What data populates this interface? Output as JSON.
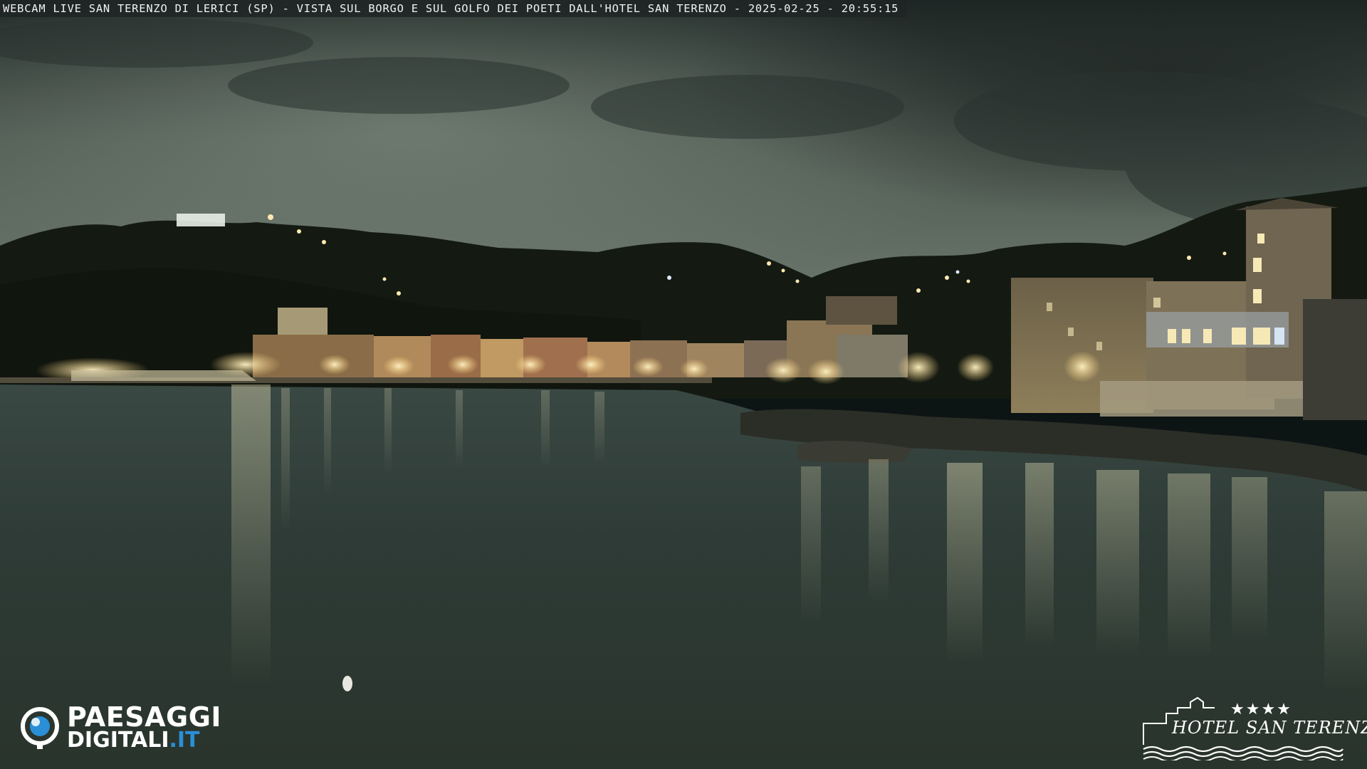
{
  "caption": {
    "text": "WEBCAM LIVE SAN TERENZO DI LERICI (SP) - VISTA SUL BORGO E SUL GOLFO DEI POETI DALL'HOTEL SAN TERENZO - 2025-02-25 - 20:55:15"
  },
  "logo_left": {
    "line1": "PAESAGGI",
    "line2_main": "DIGITALI",
    "line2_tld": ".IT",
    "icon": "camera-eye-icon",
    "accent_color": "#2a8fd6"
  },
  "logo_right": {
    "stars": "★★★★",
    "name": "HOTEL SAN TERENZO",
    "icon": "castle-waves-icon"
  },
  "scene": {
    "description_colors": {
      "sky": "#5e6a60",
      "hills": "#141a12",
      "water": "#2d3a34",
      "lights": "#ffd98a"
    }
  }
}
